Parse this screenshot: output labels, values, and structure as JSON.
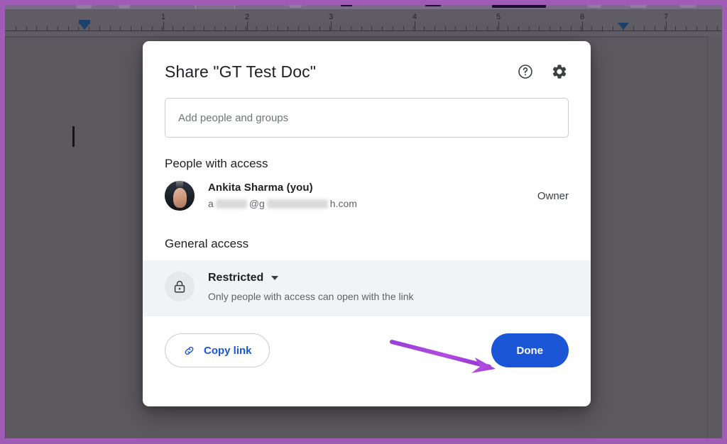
{
  "app": {
    "document_name": "GT Test Doc"
  },
  "ruler": {
    "numbers": [
      "1",
      "2",
      "3",
      "4",
      "5",
      "6",
      "7"
    ],
    "left_indent_marker": "first-line-indent-marker",
    "right_indent_marker": "right-indent-marker"
  },
  "dialog": {
    "title": "Share \"GT Test Doc\"",
    "help_icon": "help-circle-icon",
    "settings_icon": "gear-icon",
    "search": {
      "value": "",
      "placeholder": "Add people and groups"
    },
    "people_section": {
      "heading": "People with access",
      "members": [
        {
          "name": "Ankita Sharma (you)",
          "email_prefix": "a",
          "email_middle": "@g",
          "email_suffix": "h.com",
          "role": "Owner",
          "avatar": "user-avatar"
        }
      ]
    },
    "general_access": {
      "heading": "General access",
      "icon": "lock-icon",
      "value": "Restricted",
      "description": "Only people with access can open with the link",
      "caret": "chevron-down-icon"
    },
    "footer": {
      "copy_link_label": "Copy link",
      "copy_link_icon": "link-chain-icon",
      "done_label": "Done"
    }
  },
  "annotation": {
    "arrow_color": "#a23fe0",
    "points_to": "done-button"
  },
  "colors": {
    "accent_blue": "#1a56d6",
    "band_gray": "#f1f3f4",
    "scrim": "#6a676d",
    "capture_border": "#a05bb5"
  }
}
